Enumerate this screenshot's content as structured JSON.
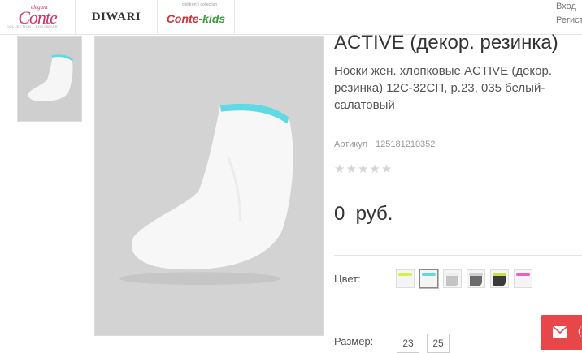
{
  "header": {
    "brands": [
      {
        "name": "Conte",
        "small": "elegant",
        "tagline": "COLLECTION · BODYWEAR"
      },
      {
        "name": "DIWARI"
      },
      {
        "name_part1": "Conte",
        "name_part2": "-kids",
        "small": "children's collection"
      }
    ],
    "login_label": "Вход",
    "register_label": "Регист"
  },
  "product": {
    "title": "ACTIVE (декор. резинка)",
    "description": "Носки жен. хлопковые ACTIVE (декор. резинка) 12С-32СП, р.23, 035 белый-салатовый",
    "sku_label": "Артикул",
    "sku_value": "125181210352",
    "rating": 0,
    "rating_max": 5,
    "price": "0  руб.",
    "color_label": "Цвет:",
    "colors": [
      {
        "body": "#f4f4f4",
        "cuff": "#d6f04a"
      },
      {
        "body": "#f4f4f4",
        "cuff": "#5fd9e4",
        "selected": true
      },
      {
        "body": "#c4c4c4",
        "cuff": "#eeeeee"
      },
      {
        "body": "#6b6b6b",
        "cuff": "#d0d0d0"
      },
      {
        "body": "#3b3b3b",
        "cuff": "#c9e04a"
      },
      {
        "body": "#f4f4f4",
        "cuff": "#e85ec4"
      }
    ],
    "size_label": "Размер:",
    "sizes": [
      "23",
      "25"
    ]
  },
  "colors": {
    "brand": "#d0336a",
    "contact": "#e8474a",
    "sock_cuff": "#5fd9e4"
  }
}
